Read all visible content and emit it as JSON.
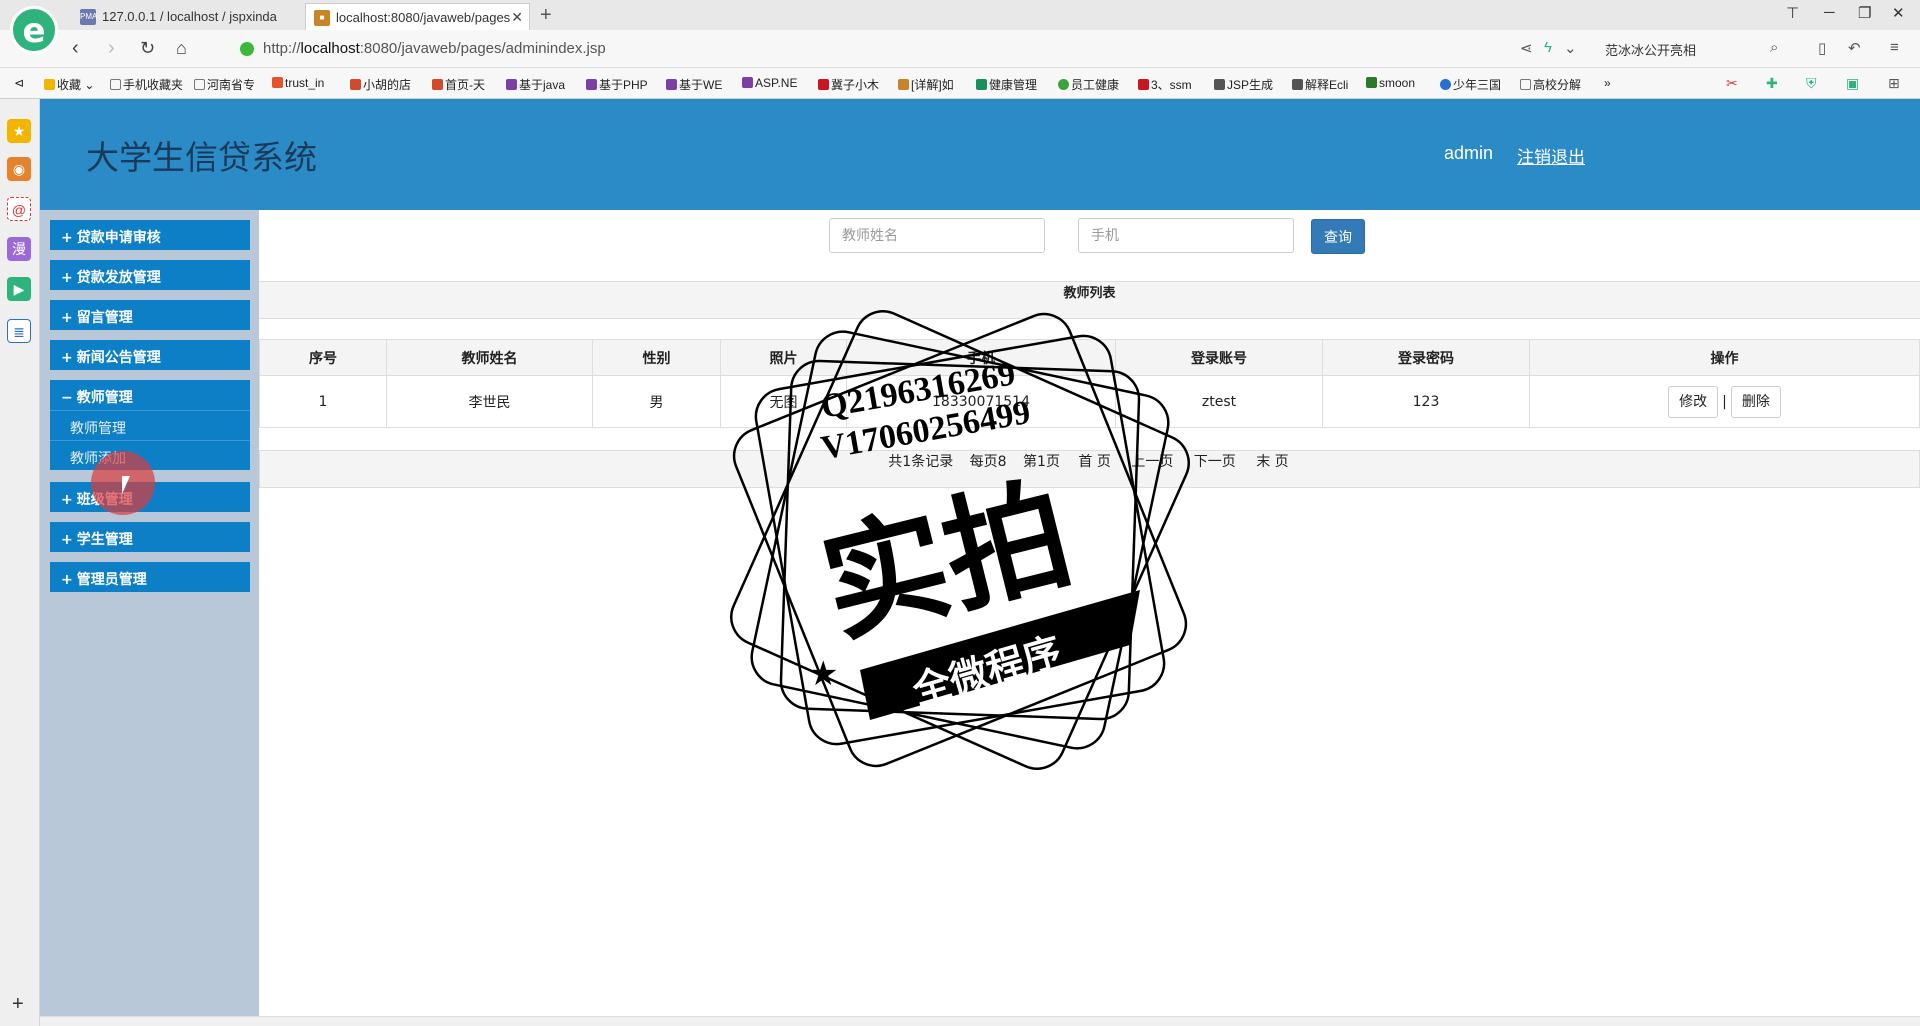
{
  "browser": {
    "logo": "e",
    "tabs": [
      {
        "favicon": "PMA",
        "label": "127.0.0.1 / localhost / jspxinda"
      },
      {
        "favicon": "■",
        "label": "localhost:8080/javaweb/pages"
      }
    ],
    "url_prefix": "http://",
    "url_host": "localhost",
    "url_rest": ":8080/javaweb/pages/adminindex.jsp",
    "search_text": "范冰冰公开亮相",
    "bookmarks": [
      "收藏",
      "手机收藏夹",
      "河南省专",
      "trust_in",
      "小胡的店",
      "首页-天",
      "基于java",
      "基于PHP",
      "基于WE",
      "ASP.NE",
      "冀子小木",
      "[详解]如",
      "健康管理",
      "员工健康",
      "3、ssm",
      "JSP生成",
      "解释Ecli",
      "smoon",
      "少年三国",
      "高校分解"
    ],
    "bookmark_more": "»"
  },
  "app": {
    "title": "大学生信贷系统",
    "user": "admin",
    "logout": "注销退出"
  },
  "sidebar": {
    "menus": [
      {
        "sign": "+",
        "label": "贷款申请审核"
      },
      {
        "sign": "+",
        "label": "贷款发放管理"
      },
      {
        "sign": "+",
        "label": "留言管理"
      },
      {
        "sign": "+",
        "label": "新闻公告管理"
      },
      {
        "sign": "−",
        "label": "教师管理"
      },
      {
        "sign": "+",
        "label": "班级管理"
      },
      {
        "sign": "+",
        "label": "学生管理"
      },
      {
        "sign": "+",
        "label": "管理员管理"
      }
    ],
    "submenu": [
      "教师管理",
      "教师添加"
    ]
  },
  "search": {
    "name_placeholder": "教师姓名",
    "phone_placeholder": "手机",
    "query_label": "查询"
  },
  "table": {
    "title": "教师列表",
    "headers": [
      "序号",
      "教师姓名",
      "性别",
      "照片",
      "手机",
      "登录账号",
      "登录密码",
      "操作"
    ],
    "rows": [
      {
        "no": "1",
        "name": "李世民",
        "gender": "男",
        "photo": "无图",
        "phone": "18330071514",
        "account": "ztest",
        "password": "123",
        "edit": "修改",
        "sep": "|",
        "delete": "删除"
      }
    ]
  },
  "pager": {
    "total": "共1条记录",
    "per_page": "每页8",
    "page": "第1页",
    "first": "首 页",
    "prev": "上一页",
    "next": "下一页",
    "last": "末 页"
  },
  "stamp": {
    "line1": "Q2196316269",
    "line2": "V17060256499",
    "big": "实拍",
    "banner": "全微程序"
  }
}
